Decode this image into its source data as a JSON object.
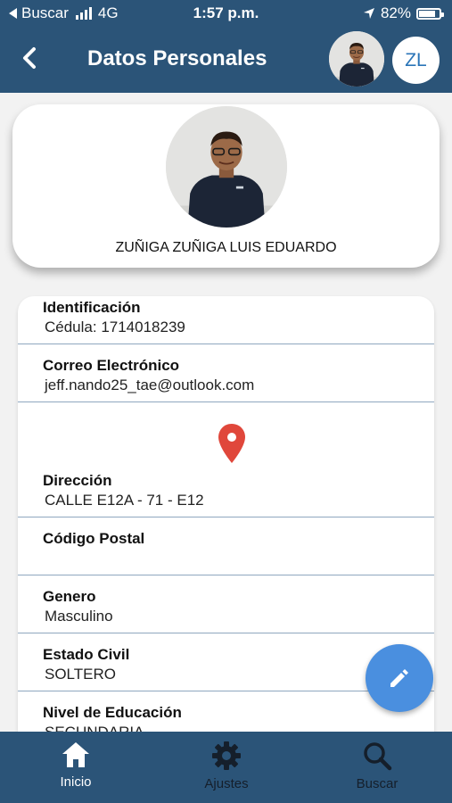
{
  "status_bar": {
    "back_app": "Buscar",
    "network": "4G",
    "time": "1:57 p.m.",
    "battery": "82%",
    "battery_level": 0.82
  },
  "header": {
    "title": "Datos Personales",
    "initials": "ZL"
  },
  "profile": {
    "name": "ZUÑIGA ZUÑIGA LUIS EDUARDO"
  },
  "fields": {
    "identificacion": {
      "label": "Identificación",
      "value": "Cédula: 1714018239"
    },
    "correo": {
      "label": "Correo Electrónico",
      "value": "jeff.nando25_tae@outlook.com"
    },
    "direccion": {
      "label": "Dirección",
      "value": "CALLE E12A - 71 - E12"
    },
    "codigo_postal": {
      "label": "Código Postal",
      "value": ""
    },
    "genero": {
      "label": "Genero",
      "value": "Masculino"
    },
    "estado_civil": {
      "label": "Estado Civil",
      "value": "SOLTERO"
    },
    "nivel_educacion": {
      "label": "Nivel de Educación",
      "value": "SECUNDARIA"
    }
  },
  "bottom_nav": [
    {
      "label": "Inicio",
      "icon": "home-icon",
      "active": true
    },
    {
      "label": "Ajustes",
      "icon": "gear-icon",
      "active": false
    },
    {
      "label": "Buscar",
      "icon": "search-icon",
      "active": false
    }
  ],
  "colors": {
    "primary": "#2b5478",
    "fab": "#4a8fdf",
    "pin": "#e0473b",
    "divider": "#8fa7bf",
    "nav_inactive": "#151f2b"
  }
}
